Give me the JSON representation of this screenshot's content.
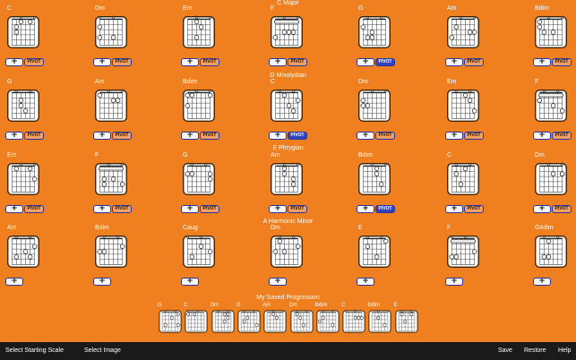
{
  "sections": [
    {
      "title": "C Major",
      "chords": [
        {
          "name": "C",
          "pivot": true,
          "pivot_label": "PIVOT",
          "pivot_active": false,
          "barre": false
        },
        {
          "name": "Dm",
          "pivot": true,
          "pivot_label": "PIVOT",
          "pivot_active": false,
          "barre": false
        },
        {
          "name": "Em",
          "pivot": true,
          "pivot_label": "PIVOT",
          "pivot_active": false,
          "barre": false
        },
        {
          "name": "F",
          "pivot": true,
          "pivot_label": "PIVOT",
          "pivot_active": false,
          "barre": true
        },
        {
          "name": "G",
          "pivot": true,
          "pivot_label": "PIVOT",
          "pivot_active": true,
          "barre": false
        },
        {
          "name": "Am",
          "pivot": true,
          "pivot_label": "PIVOT",
          "pivot_active": false,
          "barre": false
        },
        {
          "name": "Bdim",
          "pivot": true,
          "pivot_label": "PIVOT",
          "pivot_active": false,
          "barre": false
        }
      ]
    },
    {
      "title": "G Mixolydian",
      "chords": [
        {
          "name": "G",
          "pivot": true,
          "pivot_label": "PIVOT",
          "pivot_active": false,
          "barre": false
        },
        {
          "name": "Am",
          "pivot": true,
          "pivot_label": "PIVOT",
          "pivot_active": false,
          "barre": false
        },
        {
          "name": "Bdim",
          "pivot": true,
          "pivot_label": "PIVOT",
          "pivot_active": false,
          "barre": false
        },
        {
          "name": "C",
          "pivot": true,
          "pivot_label": "PIVOT",
          "pivot_active": true,
          "barre": false
        },
        {
          "name": "Dm",
          "pivot": true,
          "pivot_label": "PIVOT",
          "pivot_active": false,
          "barre": false
        },
        {
          "name": "Em",
          "pivot": true,
          "pivot_label": "PIVOT",
          "pivot_active": false,
          "barre": false
        },
        {
          "name": "F",
          "pivot": true,
          "pivot_label": "PIVOT",
          "pivot_active": false,
          "barre": true
        }
      ]
    },
    {
      "title": "E Phrygian",
      "chords": [
        {
          "name": "Em",
          "pivot": true,
          "pivot_label": "PIVOT",
          "pivot_active": false,
          "barre": false
        },
        {
          "name": "F",
          "pivot": true,
          "pivot_label": "PIVOT",
          "pivot_active": false,
          "barre": true
        },
        {
          "name": "G",
          "pivot": true,
          "pivot_label": "PIVOT",
          "pivot_active": false,
          "barre": false
        },
        {
          "name": "Am",
          "pivot": true,
          "pivot_label": "PIVOT",
          "pivot_active": false,
          "barre": false
        },
        {
          "name": "Bdim",
          "pivot": true,
          "pivot_label": "PIVOT",
          "pivot_active": true,
          "barre": false
        },
        {
          "name": "C",
          "pivot": true,
          "pivot_label": "PIVOT",
          "pivot_active": false,
          "barre": false
        },
        {
          "name": "Dm",
          "pivot": true,
          "pivot_label": "PIVOT",
          "pivot_active": false,
          "barre": false
        }
      ]
    },
    {
      "title": "A Harmonic Minor",
      "chords": [
        {
          "name": "Am",
          "pivot": false,
          "barre": false
        },
        {
          "name": "Bdim",
          "pivot": false,
          "barre": false
        },
        {
          "name": "Caug",
          "pivot": false,
          "barre": false
        },
        {
          "name": "Dm",
          "pivot": false,
          "barre": false
        },
        {
          "name": "E",
          "pivot": false,
          "barre": false
        },
        {
          "name": "F",
          "pivot": false,
          "barre": true
        },
        {
          "name": "G#dim",
          "pivot": false,
          "barre": false
        }
      ]
    }
  ],
  "saved": {
    "title": "My Saved Progression",
    "chords": [
      "G",
      "C",
      "Dm",
      "G",
      "Am",
      "Dm",
      "Bdim",
      "C",
      "Bdim",
      "E"
    ]
  },
  "plus_label": "+",
  "bottom_bar": {
    "select_scale": "Select Starting Scale",
    "select_image": "Select Image",
    "save": "Save",
    "restore": "Restore",
    "help": "Help"
  }
}
